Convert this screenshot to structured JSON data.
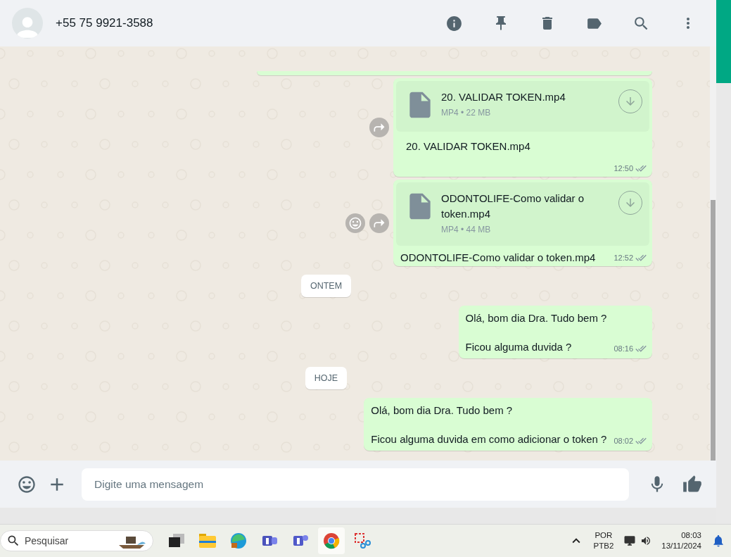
{
  "header": {
    "contact": "+55 75 9921-3588"
  },
  "messages": [
    {
      "kind": "cut"
    },
    {
      "kind": "file",
      "file_name": "20. VALIDAR TOKEN.mp4",
      "file_meta": "MP4 • 22 MB",
      "caption": "20.  VALIDAR TOKEN.mp4",
      "time": "12:50",
      "reaction_button": false
    },
    {
      "kind": "file",
      "file_name": "ODONTOLIFE-Como validar o token.mp4",
      "file_meta": "MP4 • 44 MB",
      "caption": "ODONTOLIFE-Como validar o token.mp4",
      "time": "12:52",
      "reaction_button": true
    },
    {
      "kind": "date",
      "label": "ONTEM"
    },
    {
      "kind": "text",
      "lines": [
        "Olá, bom dia Dra. Tudo bem ?",
        "Ficou alguma duvida ?"
      ],
      "time": "08:16"
    },
    {
      "kind": "date",
      "label": "HOJE"
    },
    {
      "kind": "text",
      "lines": [
        "Olá, bom dia Dra. Tudo bem ?",
        "Ficou alguma duvida em como adicionar o token ?"
      ],
      "time": "08:02"
    }
  ],
  "composer": {
    "placeholder": "Digite uma mensagem"
  },
  "taskbar": {
    "search_placeholder": "Pesquisar",
    "language": "POR",
    "layout": "PTB2",
    "time": "08:03",
    "date": "13/11/2024"
  }
}
